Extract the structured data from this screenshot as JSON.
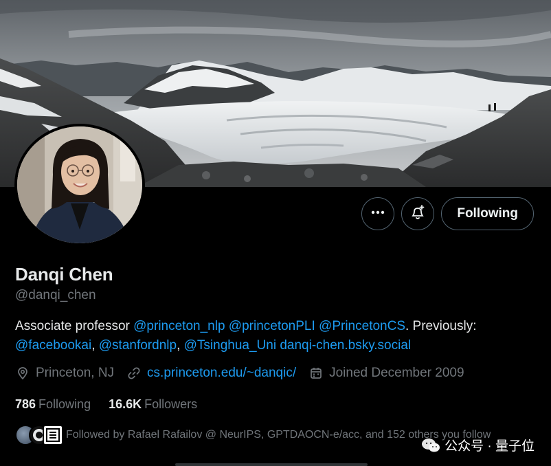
{
  "profile": {
    "name": "Danqi Chen",
    "handle": "@danqi_chen",
    "bio": {
      "p1": "Associate professor ",
      "m1": "@princeton_nlp",
      "s1": " ",
      "m2": "@princetonPLI",
      "s2": " ",
      "m3": "@PrincetonCS",
      "p2": ". Previously:",
      "m4": "@facebookai",
      "c1": ", ",
      "m5": "@stanfordnlp",
      "c2": ", ",
      "m6": "@Tsinghua_Uni",
      "s3": " ",
      "m7": "danqi-chen.bsky.social"
    },
    "location": "Princeton, NJ",
    "website": "cs.princeton.edu/~danqic/",
    "joined": "Joined December 2009"
  },
  "stats": {
    "following_count": "786",
    "following_label": "Following",
    "followers_count": "16.6K",
    "followers_label": "Followers"
  },
  "followed_by": "Followed by Rafael Rafailov @ NeurIPS, GPTDAOCN-e/acc, and 152 others you follow",
  "actions": {
    "follow_label": "Following",
    "more_icon": "more-icon",
    "notify_icon": "bell-plus-icon"
  },
  "watermark": "公众号 · 量子位",
  "colors": {
    "background": "#000000",
    "link": "#1d9bf0",
    "muted": "#71767b",
    "text": "#e7e9ea"
  }
}
